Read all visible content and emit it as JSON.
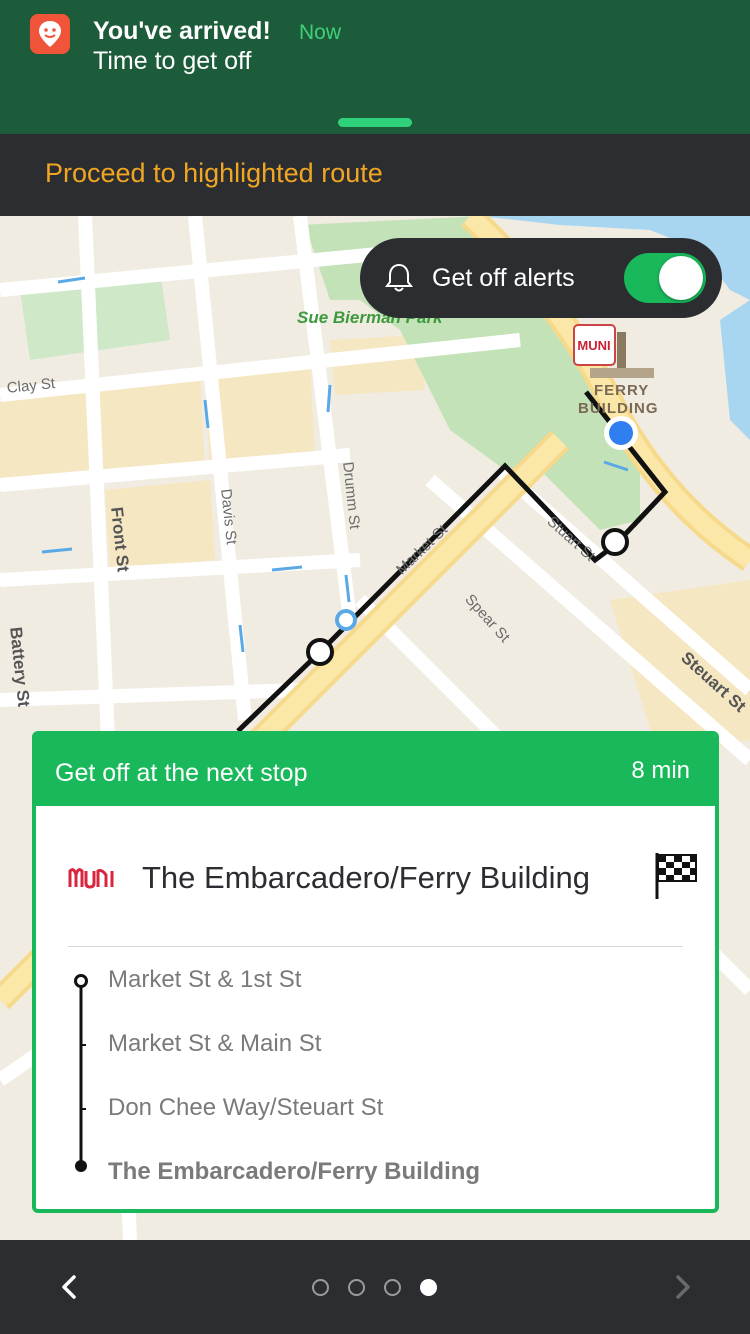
{
  "notification": {
    "title": "You've arrived!",
    "time": "Now",
    "body": "Time to get off"
  },
  "instruction": "Proceed to highlighted route",
  "map": {
    "park": "Sue Bierman Park",
    "streets": {
      "clay": "Clay St",
      "front": "Front St",
      "davis": "Davis St",
      "drumm": "Drumm St",
      "market": "Market St",
      "spear": "Spear St",
      "steuart": "Steuart St",
      "steuart_short": "Stuart St",
      "battery": "Battery St"
    },
    "poi": {
      "ferry_line1": "FERRY",
      "ferry_line2": "BUILDING"
    }
  },
  "alerts": {
    "label": "Get off alerts",
    "enabled": true
  },
  "card": {
    "header_title": "Get off at the next stop",
    "header_time": "8 min",
    "destination": "The Embarcadero/Ferry Building",
    "stops": [
      "Market St & 1st St",
      "Market St & Main St",
      "Don Chee Way/Steuart St",
      "The Embarcadero/Ferry Building"
    ]
  },
  "pager": {
    "count": 4,
    "active": 3
  },
  "colors": {
    "accent": "#18b85b",
    "instruction": "#f0a623",
    "notification_bg": "#1d5c3b",
    "bar_bg": "#2b2d30"
  }
}
